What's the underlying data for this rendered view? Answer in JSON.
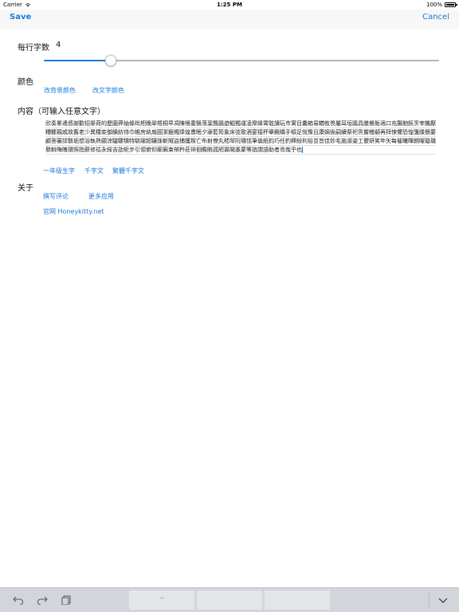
{
  "status_bar": {
    "carrier": "Carrier",
    "time": "1:25 PM",
    "battery": "100%"
  },
  "nav": {
    "save_label": "Save",
    "cancel_label": "Cancel"
  },
  "chars_per_line": {
    "label": "每行字数",
    "value": "4",
    "slider_fraction": 0.17
  },
  "color": {
    "label": "颜色",
    "change_bg": "改背景颜色",
    "change_text": "改文字颜色"
  },
  "content": {
    "label": "内容（可输入任意文字）",
    "text": "欣奏累遣慼謝歡招渠荷的歷園莽抽條枇杷晚翠梧桐早凋陳根委翳落葉飄颻遊鯤獨運凌摩絳霄耽讀玩市寓目囊箱易輶攸畏屬耳垣牆具膳餐飯適口充腸飽飫烹宰饑厭糟糠親戚故舊老少異糧妾御績紡侍巾帷房紈扇圓潔銀燭煒煌晝眠夕寐藍筍象床弦歌酒宴接杯舉觴矯手頓足悅豫且康嫡後嗣續祭祀烝嘗稽顙再拜悚懼恐惶箋牒簡要顧答審詳骸垢想浴執熱願涼驢騾犢特駭躍超驤誅斬賊盜捕獲叛亡布射僚丸嵇琴阮嘯恬筆倫紙鈞巧任釣釋紛利俗並皆佳妙毛施淑姿工顰妍笑年矢每催曦暉朗曜璇璣懸斡晦魄環照指薪修祜永綏吉劭矩步引領俯仰廊廟束帶矜莊徘徊瞻眺孤陋寡聞愚蒙等誚謂語助者焉哉乎也"
  },
  "presets": {
    "first_grade": "一年级生字",
    "thousand_chars": "千字文",
    "traditional_thousand": "繁體千字文"
  },
  "about": {
    "label": "关于",
    "write_review": "撰写评论",
    "more_apps": "更多应用",
    "website": "官网 Honeykitty.net"
  },
  "toolbar": {
    "undo_icon": "undo-icon",
    "redo_icon": "redo-icon",
    "paste_icon": "paste-icon",
    "suggestion_1": "\"\"",
    "suggestion_2": "",
    "suggestion_3": "",
    "dismiss_icon": "chevron-down-icon"
  },
  "colors": {
    "accent": "#1a7bd9",
    "toolbar_bg": "#d2d5db"
  }
}
